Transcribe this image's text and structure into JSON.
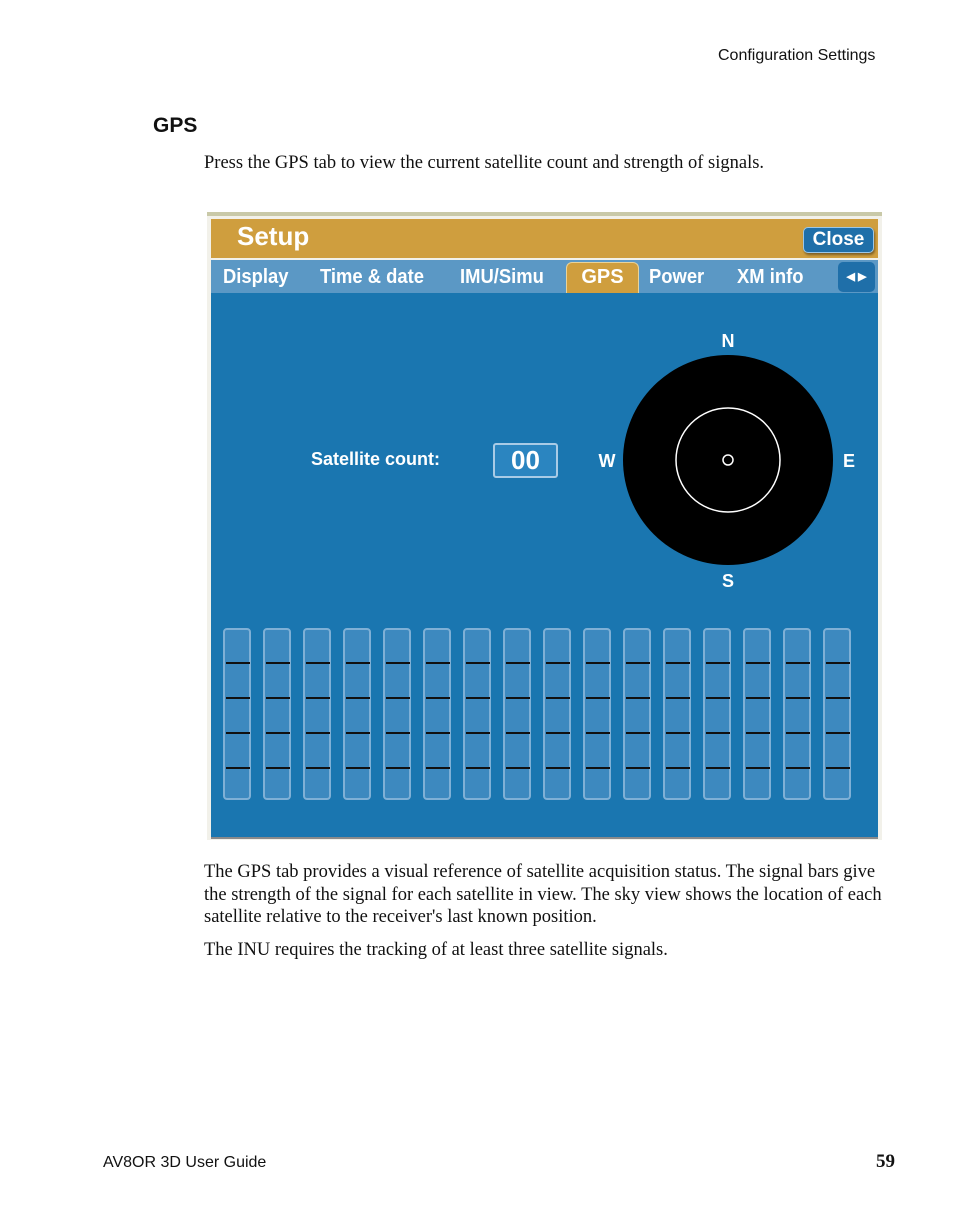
{
  "header": {
    "section": "Configuration Settings"
  },
  "heading": "GPS",
  "intro": "Press the GPS tab to view the current satellite count and strength of signals.",
  "setup": {
    "title": "Setup",
    "close_label": "Close",
    "tabs": [
      {
        "label": "Display"
      },
      {
        "label": "Time & date"
      },
      {
        "label": "IMU/Simu"
      },
      {
        "label": "GPS",
        "active": true
      },
      {
        "label": "Power"
      },
      {
        "label": "XM info"
      }
    ],
    "tab_scroll_icon": "left-right-arrows",
    "satellite_count_label": "Satellite count:",
    "satellite_count": "00",
    "compass": {
      "n": "N",
      "s": "S",
      "e": "E",
      "w": "W"
    },
    "signal_bars": {
      "count": 16,
      "levels": [
        0,
        0,
        0,
        0,
        0,
        0,
        0,
        0,
        0,
        0,
        0,
        0,
        0,
        0,
        0,
        0
      ]
    },
    "colors": {
      "title_bar": "#cf9e3e",
      "tab_bar": "#5b98c5",
      "panel": "#1a76b0",
      "sky": "#000000"
    }
  },
  "paragraphs": [
    "The GPS tab provides a visual reference of satellite acquisition status. The signal bars give the strength of the signal for each satellite in view. The sky view shows the location of each satellite relative to the receiver's last known position.",
    "The INU requires the tracking of at least three satellite signals."
  ],
  "footer": {
    "guide": "AV8OR 3D User Guide",
    "page": "59"
  }
}
